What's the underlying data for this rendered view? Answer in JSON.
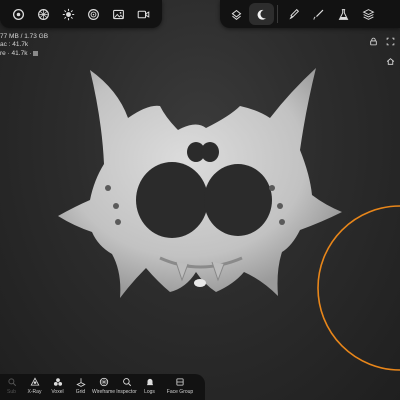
{
  "toolbar_left": {
    "items": [
      {
        "name": "file-menu-icon"
      },
      {
        "name": "scene-menu-icon"
      },
      {
        "name": "light-menu-icon"
      },
      {
        "name": "material-menu-icon"
      },
      {
        "name": "image-menu-icon"
      },
      {
        "name": "video-menu-icon"
      }
    ]
  },
  "toolbar_right": {
    "items": [
      {
        "name": "layers-icon"
      },
      {
        "name": "moon-icon"
      },
      {
        "name": "brush-icon"
      },
      {
        "name": "stroke-icon"
      },
      {
        "name": "flask-icon"
      },
      {
        "name": "stack-icon"
      }
    ]
  },
  "stats": {
    "memory": "77 MB / 1.73 GB",
    "scene": "ac : 41.7k",
    "object": "re · 41.7k ·"
  },
  "bottom_bar": {
    "items": [
      {
        "label": "Sub",
        "name": "subdivide-tool"
      },
      {
        "label": "X-Ray",
        "name": "xray-tool"
      },
      {
        "label": "Voxel",
        "name": "voxel-tool"
      },
      {
        "label": "Grid",
        "name": "grid-tool"
      },
      {
        "label": "Wireframe",
        "name": "wireframe-tool"
      },
      {
        "label": "Inspector",
        "name": "inspector-tool"
      },
      {
        "label": "Logs",
        "name": "logs-tool"
      },
      {
        "label": "Face Group",
        "name": "face-group-tool"
      }
    ]
  },
  "colors": {
    "accent_ring": "#e8861a",
    "model": "#c9c9c9",
    "toolbar_bg": "#121212"
  }
}
